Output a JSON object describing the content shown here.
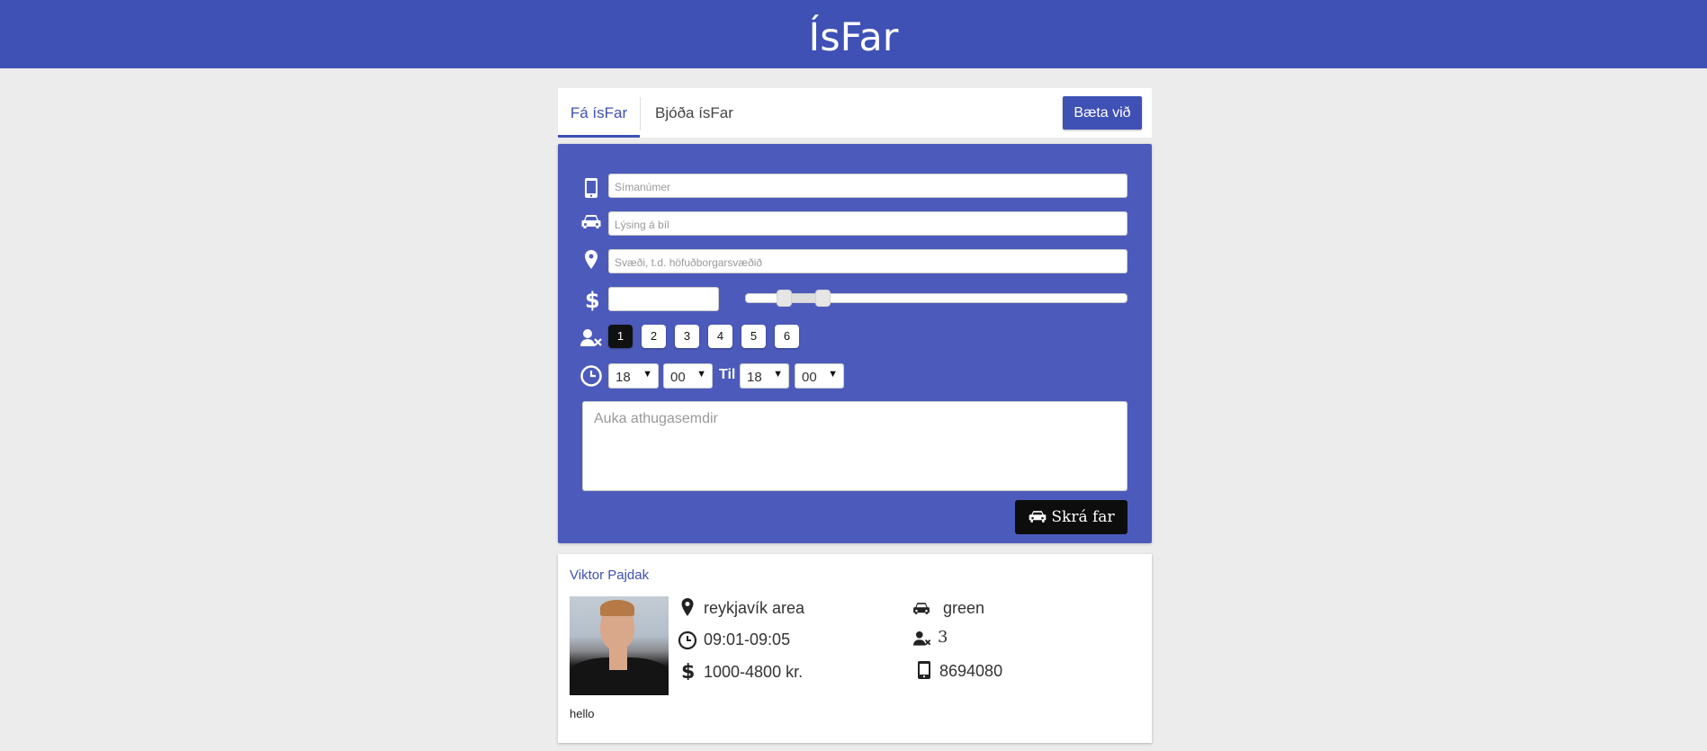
{
  "app": {
    "title": "ÍsFar"
  },
  "tabs": [
    {
      "label": "Fá ísFar",
      "active": true
    },
    {
      "label": "Bjóða ísFar",
      "active": false
    }
  ],
  "add_button": "Bæta við",
  "form": {
    "phone_placeholder": "Símanúmer",
    "car_placeholder": "Lýsing á bíl",
    "area_placeholder": "Svæði, t.d. höfuðborgarsvæðið",
    "price_value": "",
    "seats": [
      "1",
      "2",
      "3",
      "4",
      "5",
      "6"
    ],
    "seats_selected": "1",
    "from_hour": "18",
    "from_minute": "00",
    "til_label": "Til",
    "to_hour": "18",
    "to_minute": "00",
    "comments_placeholder": "Auka athugasemdir",
    "submit_label": "Skrá far"
  },
  "listing": {
    "name": "Viktor Pajdak",
    "area": "reykjavík area",
    "time": "09:01-09:05",
    "price": "1000-4800 kr.",
    "car": "green",
    "seats": "3",
    "phone": "8694080",
    "note": "hello"
  },
  "colors": {
    "primary": "#3f51b5",
    "form_bg": "#4c5bbb",
    "background": "#ececec"
  }
}
